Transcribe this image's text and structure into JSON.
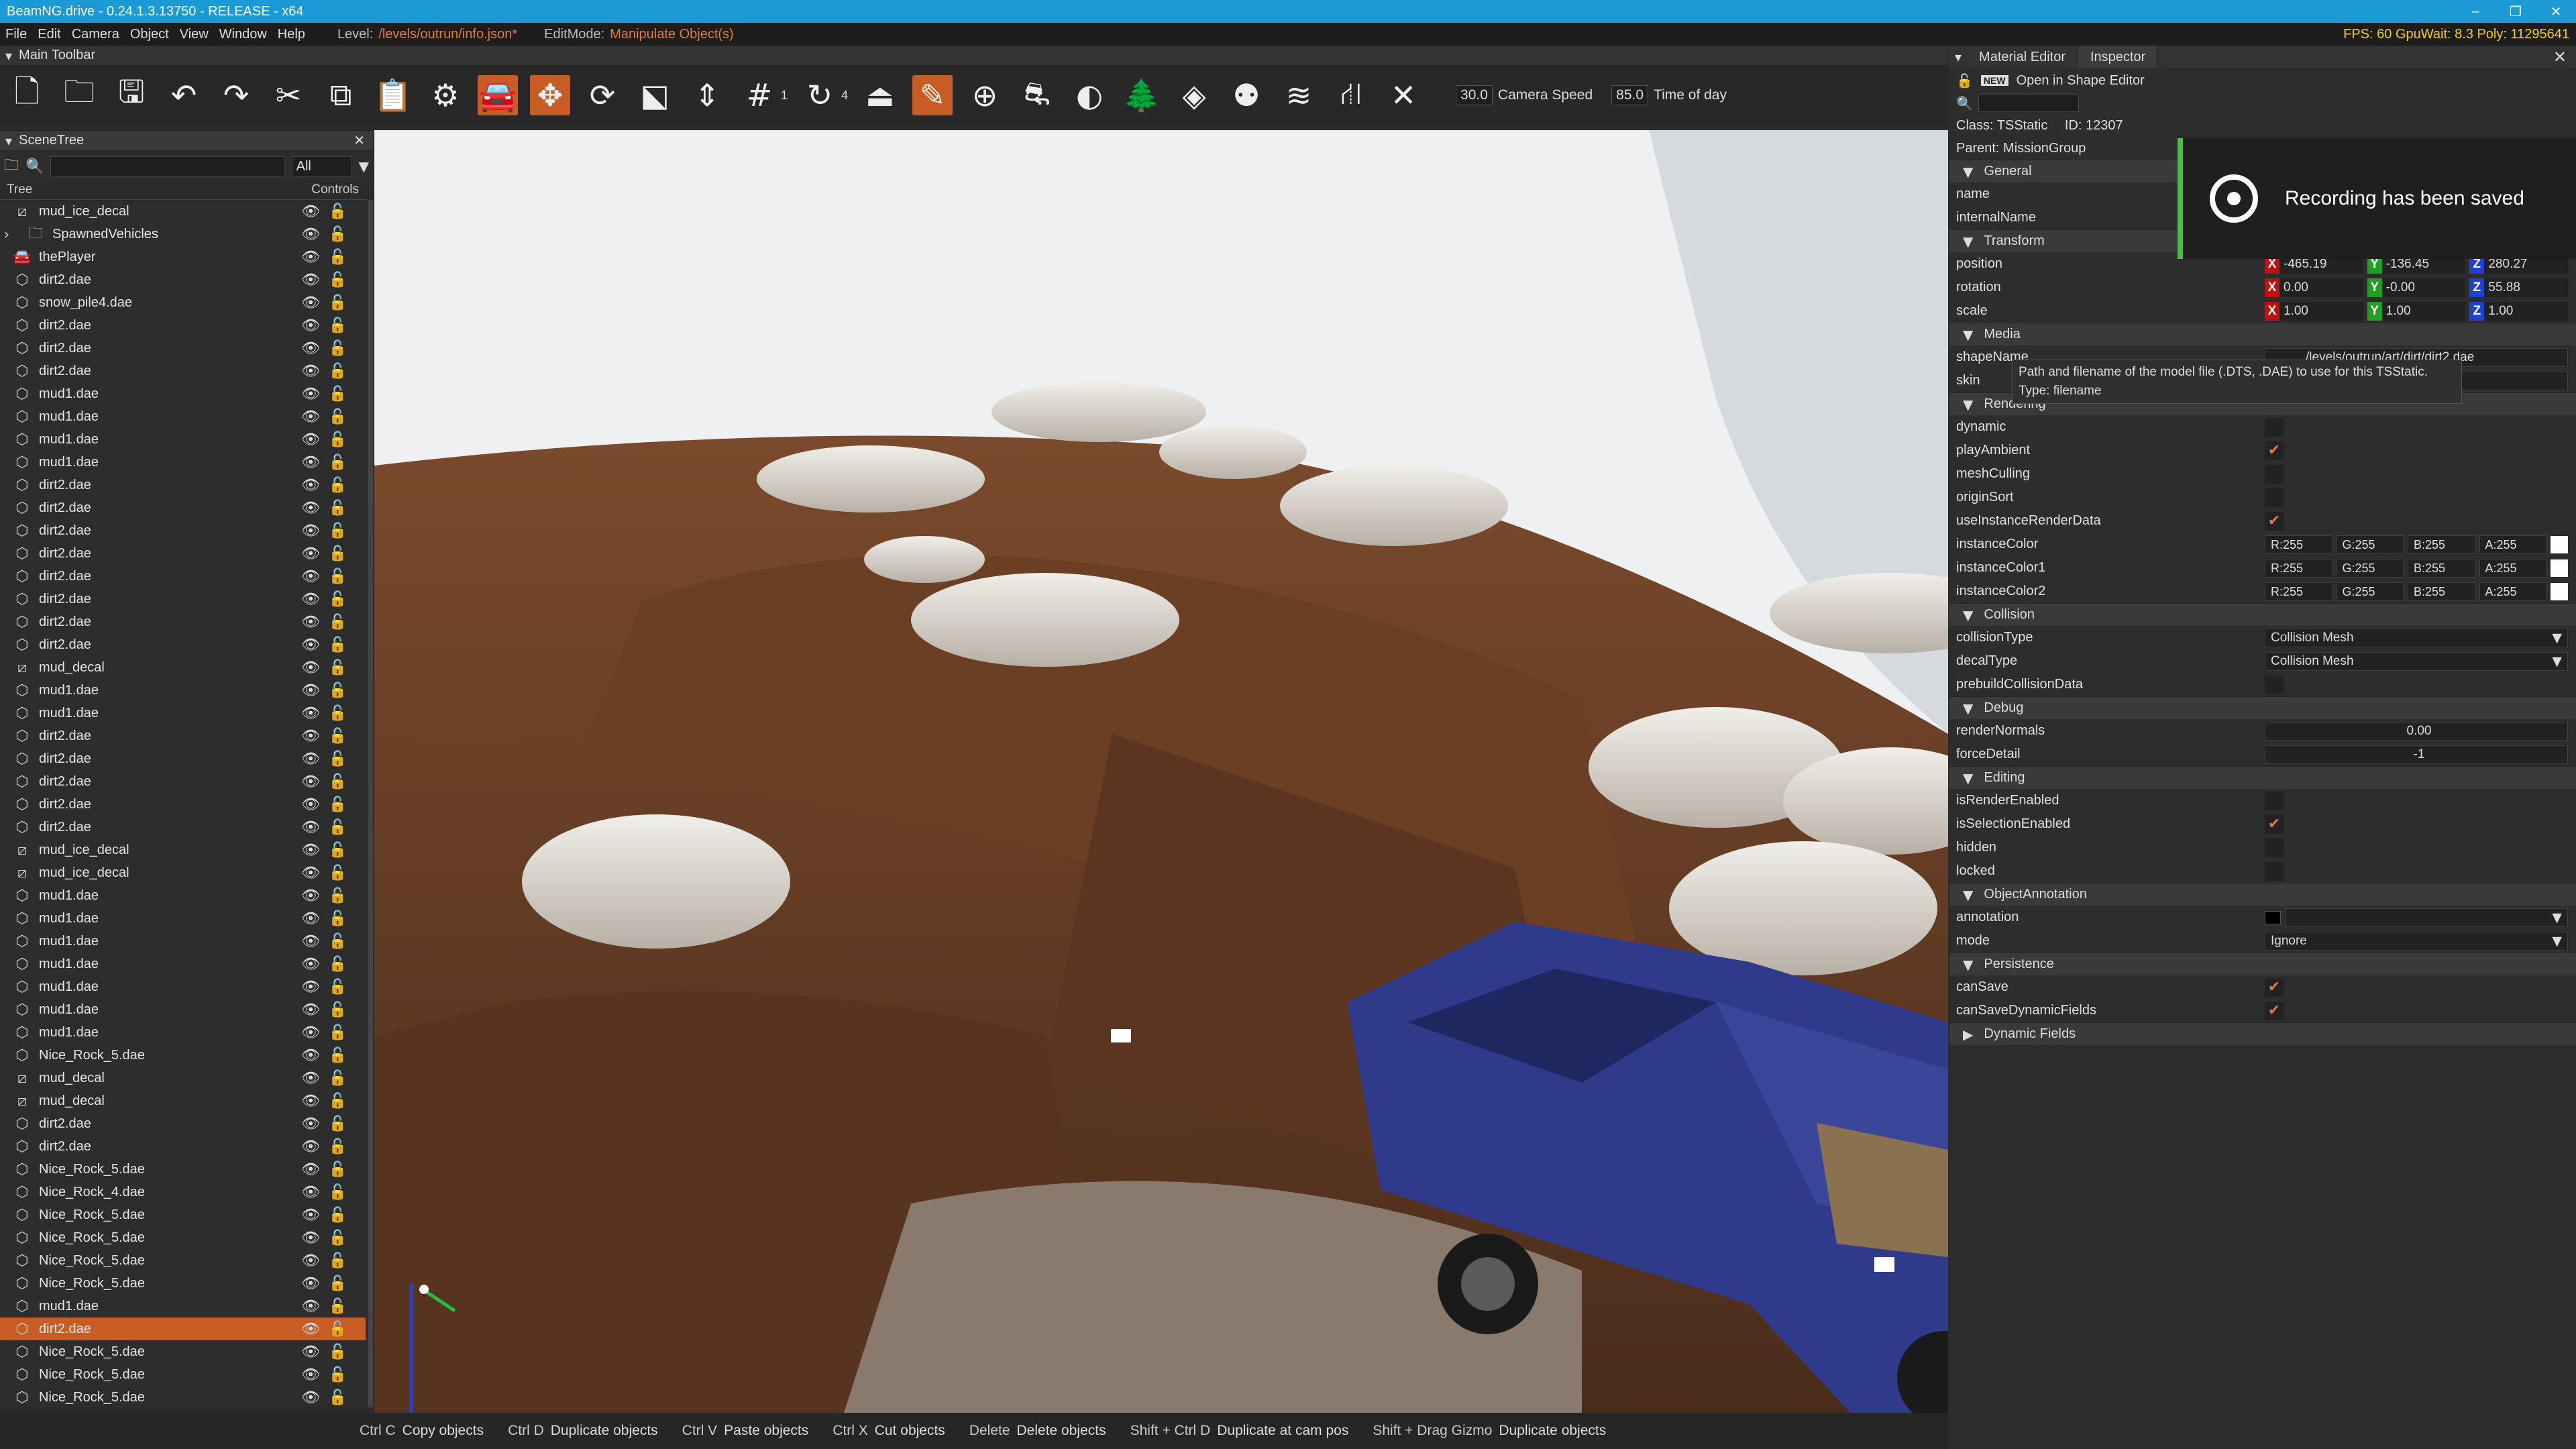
{
  "window": {
    "title": "BeamNG.drive - 0.24.1.3.13750 - RELEASE - x64",
    "fps_text": "FPS: 60 GpuWait: 8.3 Poly: 11295641"
  },
  "menu": {
    "items": [
      "File",
      "Edit",
      "Camera",
      "Object",
      "View",
      "Window",
      "Help"
    ],
    "level_label": "Level:",
    "level_value": "/levels/outrun/info.json*",
    "editmode_label": "EditMode:",
    "editmode_value": "Manipulate Object(s)"
  },
  "toolbar": {
    "header": "Main Toolbar",
    "snap_1": "1",
    "snap_4": "4",
    "camera_speed_value": "30.0",
    "camera_speed_label": "Camera Speed",
    "time_of_day_value": "85.0",
    "time_of_day_label": "Time of day"
  },
  "scenetree": {
    "header": "SceneTree",
    "filter": "All",
    "col_tree": "Tree",
    "col_controls": "Controls",
    "items": [
      {
        "label": "mud_ice_decal",
        "type": "decal"
      },
      {
        "label": "SpawnedVehicles",
        "type": "folder"
      },
      {
        "label": "thePlayer",
        "type": "vehicle"
      },
      {
        "label": "dirt2.dae",
        "type": "mesh"
      },
      {
        "label": "snow_pile4.dae",
        "type": "mesh"
      },
      {
        "label": "dirt2.dae",
        "type": "mesh"
      },
      {
        "label": "dirt2.dae",
        "type": "mesh"
      },
      {
        "label": "dirt2.dae",
        "type": "mesh"
      },
      {
        "label": "mud1.dae",
        "type": "mesh"
      },
      {
        "label": "mud1.dae",
        "type": "mesh"
      },
      {
        "label": "mud1.dae",
        "type": "mesh"
      },
      {
        "label": "mud1.dae",
        "type": "mesh"
      },
      {
        "label": "dirt2.dae",
        "type": "mesh"
      },
      {
        "label": "dirt2.dae",
        "type": "mesh"
      },
      {
        "label": "dirt2.dae",
        "type": "mesh"
      },
      {
        "label": "dirt2.dae",
        "type": "mesh"
      },
      {
        "label": "dirt2.dae",
        "type": "mesh"
      },
      {
        "label": "dirt2.dae",
        "type": "mesh"
      },
      {
        "label": "dirt2.dae",
        "type": "mesh"
      },
      {
        "label": "dirt2.dae",
        "type": "mesh"
      },
      {
        "label": "mud_decal",
        "type": "decal"
      },
      {
        "label": "mud1.dae",
        "type": "mesh"
      },
      {
        "label": "mud1.dae",
        "type": "mesh"
      },
      {
        "label": "dirt2.dae",
        "type": "mesh"
      },
      {
        "label": "dirt2.dae",
        "type": "mesh"
      },
      {
        "label": "dirt2.dae",
        "type": "mesh"
      },
      {
        "label": "dirt2.dae",
        "type": "mesh"
      },
      {
        "label": "dirt2.dae",
        "type": "mesh"
      },
      {
        "label": "mud_ice_decal",
        "type": "decal"
      },
      {
        "label": "mud_ice_decal",
        "type": "decal"
      },
      {
        "label": "mud1.dae",
        "type": "mesh"
      },
      {
        "label": "mud1.dae",
        "type": "mesh"
      },
      {
        "label": "mud1.dae",
        "type": "mesh"
      },
      {
        "label": "mud1.dae",
        "type": "mesh"
      },
      {
        "label": "mud1.dae",
        "type": "mesh"
      },
      {
        "label": "mud1.dae",
        "type": "mesh"
      },
      {
        "label": "mud1.dae",
        "type": "mesh"
      },
      {
        "label": "Nice_Rock_5.dae",
        "type": "mesh"
      },
      {
        "label": "mud_decal",
        "type": "decal"
      },
      {
        "label": "mud_decal",
        "type": "decal"
      },
      {
        "label": "dirt2.dae",
        "type": "mesh"
      },
      {
        "label": "dirt2.dae",
        "type": "mesh"
      },
      {
        "label": "Nice_Rock_5.dae",
        "type": "mesh"
      },
      {
        "label": "Nice_Rock_4.dae",
        "type": "mesh"
      },
      {
        "label": "Nice_Rock_5.dae",
        "type": "mesh"
      },
      {
        "label": "Nice_Rock_5.dae",
        "type": "mesh"
      },
      {
        "label": "Nice_Rock_5.dae",
        "type": "mesh"
      },
      {
        "label": "Nice_Rock_5.dae",
        "type": "mesh"
      },
      {
        "label": "mud1.dae",
        "type": "mesh"
      },
      {
        "label": "dirt2.dae",
        "type": "mesh",
        "selected": true
      },
      {
        "label": "Nice_Rock_5.dae",
        "type": "mesh"
      },
      {
        "label": "Nice_Rock_5.dae",
        "type": "mesh"
      },
      {
        "label": "Nice_Rock_5.dae",
        "type": "mesh"
      }
    ]
  },
  "statusbar": {
    "shortcuts": [
      {
        "key": "Ctrl C",
        "desc": "Copy objects"
      },
      {
        "key": "Ctrl D",
        "desc": "Duplicate objects"
      },
      {
        "key": "Ctrl V",
        "desc": "Paste objects"
      },
      {
        "key": "Ctrl X",
        "desc": "Cut objects"
      },
      {
        "key": "Delete",
        "desc": "Delete objects"
      },
      {
        "key": "Shift + Ctrl D",
        "desc": "Duplicate at cam pos"
      },
      {
        "key": "Shift + Drag Gizmo",
        "desc": "Duplicate objects"
      }
    ]
  },
  "inspector": {
    "tab_material": "Material Editor",
    "tab_inspector": "Inspector",
    "open_shape_editor": "Open in Shape Editor",
    "class_label": "Class: TSStatic",
    "id_label": "ID: 12307",
    "parent_label": "Parent: MissionGroup",
    "sections": {
      "general": "General",
      "transform": "Transform",
      "media": "Media",
      "rendering": "Rendering",
      "collision": "Collision",
      "debug": "Debug",
      "editing": "Editing",
      "annotation": "ObjectAnnotation",
      "persistence": "Persistence",
      "dynamic": "Dynamic Fields"
    },
    "general": {
      "name": "name",
      "internalName": "internalName"
    },
    "transform": {
      "position": {
        "label": "position",
        "x": "-465.19",
        "y": "-136.45",
        "z": "280.27"
      },
      "rotation": {
        "label": "rotation",
        "x": "0.00",
        "y": "-0.00",
        "z": "55.88"
      },
      "scale": {
        "label": "scale",
        "x": "1.00",
        "y": "1.00",
        "z": "1.00"
      }
    },
    "media": {
      "shapeName_label": "shapeName",
      "shapeName_value": "/levels/outrun/art/dirt/dirt2.dae",
      "skin_label": "skin"
    },
    "rendering": {
      "dynamic": "dynamic",
      "playAmbient": "playAmbient",
      "meshCulling": "meshCulling",
      "originSort": "originSort",
      "useInstanceRenderData": "useInstanceRenderData",
      "instanceColor": "instanceColor",
      "instanceColor1": "instanceColor1",
      "instanceColor2": "instanceColor2",
      "r": "R:255",
      "g": "G:255",
      "b": "B:255",
      "a": "A:255"
    },
    "collision": {
      "collisionType_label": "collisionType",
      "collisionType_value": "Collision Mesh",
      "decalType_label": "decalType",
      "decalType_value": "Collision Mesh",
      "prebuild": "prebuildCollisionData"
    },
    "debug": {
      "renderNormals_label": "renderNormals",
      "renderNormals_value": "0.00",
      "forceDetail_label": "forceDetail",
      "forceDetail_value": "-1"
    },
    "editing": {
      "isRenderEnabled": "isRenderEnabled",
      "isSelectionEnabled": "isSelectionEnabled",
      "hidden": "hidden",
      "locked": "locked"
    },
    "annotation": {
      "annotation_label": "annotation",
      "mode_label": "mode",
      "mode_value": "Ignore"
    },
    "persistence": {
      "canSave": "canSave",
      "canSaveDynamicFields": "canSaveDynamicFields"
    },
    "tooltip_line1": "Path and filename of the model file (.DTS, .DAE) to use for this TSStatic.",
    "tooltip_line2": "Type: filename"
  },
  "toast": {
    "text": "Recording has been saved"
  },
  "colors": {
    "accent": "#c75d25",
    "titlebar": "#1c9ad6",
    "check": "#e07b39",
    "fps": "#f5d100"
  }
}
